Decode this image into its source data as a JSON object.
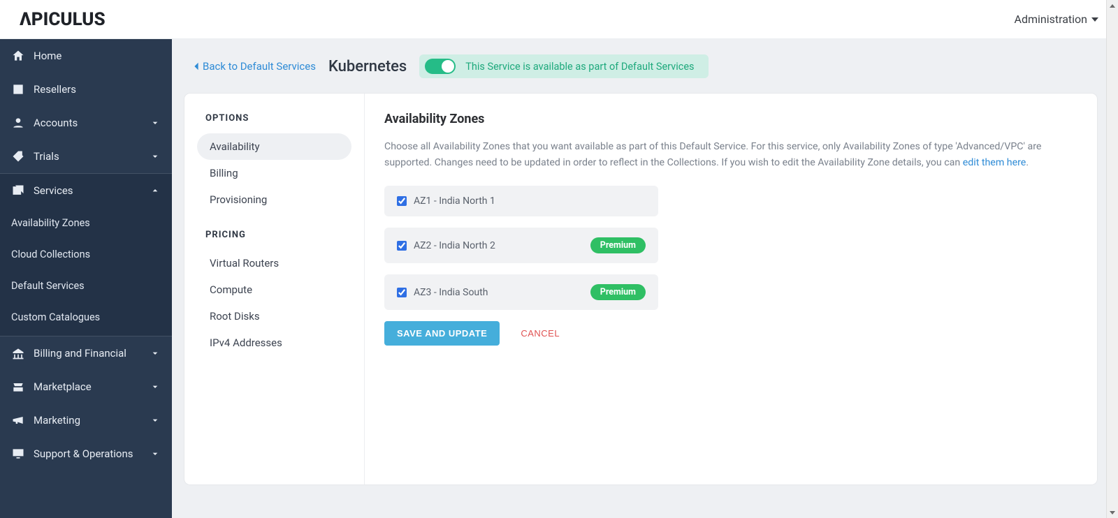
{
  "topbar": {
    "brand": "ΛPICULUS",
    "admin_label": "Administration"
  },
  "sidebar": {
    "items": [
      {
        "label": "Home",
        "icon": "home"
      },
      {
        "label": "Resellers",
        "icon": "id-badge"
      },
      {
        "label": "Accounts",
        "icon": "user-circle",
        "expandable": true
      },
      {
        "label": "Trials",
        "icon": "tag",
        "expandable": true
      },
      {
        "label": "Services",
        "icon": "collections",
        "expandable": true,
        "open": true,
        "children": [
          {
            "label": "Availability Zones"
          },
          {
            "label": "Cloud Collections"
          },
          {
            "label": "Default Services"
          },
          {
            "label": "Custom Catalogues"
          }
        ]
      },
      {
        "label": "Billing and Financial",
        "icon": "bank",
        "expandable": true
      },
      {
        "label": "Marketplace",
        "icon": "storefront",
        "expandable": true
      },
      {
        "label": "Marketing",
        "icon": "megaphone",
        "expandable": true
      },
      {
        "label": "Support & Operations",
        "icon": "monitor",
        "expandable": true
      }
    ]
  },
  "page": {
    "back_label": "Back to Default Services",
    "title": "Kubernetes",
    "availability_pill": "This Service is available as part of Default Services"
  },
  "options": {
    "heading": "OPTIONS",
    "items": [
      {
        "label": "Availability",
        "active": true
      },
      {
        "label": "Billing"
      },
      {
        "label": "Provisioning"
      }
    ]
  },
  "pricing": {
    "heading": "PRICING",
    "items": [
      {
        "label": "Virtual Routers"
      },
      {
        "label": "Compute"
      },
      {
        "label": "Root Disks"
      },
      {
        "label": "IPv4 Addresses"
      }
    ]
  },
  "az": {
    "heading": "Availability Zones",
    "desc_prefix": "Choose all Availability Zones that you want available as part of this Default Service. For this service, only Availability Zones of type 'Advanced/VPC' are supported. Changes need to be updated in order to reflect in the Collections. If you wish to edit the Availability Zone details, you can ",
    "edit_link": "edit them here",
    "desc_suffix": ".",
    "zones": [
      {
        "name": "AZ1 - India North 1",
        "checked": true
      },
      {
        "name": "AZ2 - India North 2",
        "checked": true,
        "badge": "Premium"
      },
      {
        "name": "AZ3 - India South",
        "checked": true,
        "badge": "Premium"
      }
    ],
    "save_label": "SAVE AND UPDATE",
    "cancel_label": "CANCEL"
  }
}
